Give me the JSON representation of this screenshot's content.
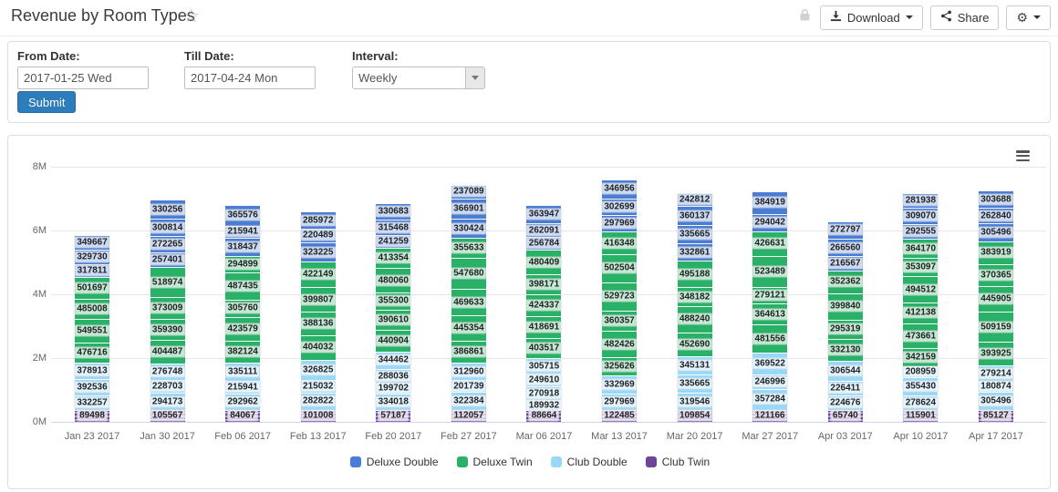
{
  "header": {
    "title": "Revenue by Room Types",
    "download_label": "Download",
    "share_label": "Share"
  },
  "icons": {
    "star": "☆",
    "gear": "⚙"
  },
  "filters": {
    "from_label": "From Date:",
    "from_value": "2017-01-25 Wed",
    "till_label": "Till Date:",
    "till_value": "2017-04-24 Mon",
    "interval_label": "Interval:",
    "interval_value": "Weekly",
    "submit_label": "Submit"
  },
  "chart_data": {
    "type": "bar",
    "stacked": true,
    "title": "",
    "xlabel": "",
    "ylabel": "",
    "ylim_m": [
      0,
      8
    ],
    "grid": true,
    "legend_position": "bottom",
    "y_ticks": [
      {
        "label": "0M",
        "m": 0
      },
      {
        "label": "2M",
        "m": 2
      },
      {
        "label": "4M",
        "m": 4
      },
      {
        "label": "6M",
        "m": 6
      },
      {
        "label": "8M",
        "m": 8
      }
    ],
    "series": [
      {
        "name": "Deluxe Double",
        "color": "#4a7dd4"
      },
      {
        "name": "Deluxe Twin",
        "color": "#28b167"
      },
      {
        "name": "Club Double",
        "color": "#99d8f9"
      },
      {
        "name": "Club Twin",
        "color": "#6f4499"
      }
    ],
    "categories": [
      "Jan 23 2017",
      "Jan 30 2017",
      "Feb 06 2017",
      "Feb 13 2017",
      "Feb 20 2017",
      "Feb 27 2017",
      "Mar 06 2017",
      "Mar 13 2017",
      "Mar 20 2017",
      "Mar 27 2017",
      "Apr 03 2017",
      "Apr 10 2017",
      "Apr 17 2017"
    ],
    "segment_order": "top-to-bottom, second item is series index",
    "bars": [
      {
        "category": "Jan 23 2017",
        "total_m": 5.86,
        "segments": [
          [
            349667,
            0
          ],
          [
            329730,
            0
          ],
          [
            317811,
            0
          ],
          [
            501697,
            1
          ],
          [
            485008,
            1
          ],
          [
            549551,
            1
          ],
          [
            476716,
            1
          ],
          [
            378913,
            2
          ],
          [
            392536,
            2
          ],
          [
            332257,
            2
          ],
          [
            89498,
            3
          ]
        ]
      },
      {
        "category": "Jan 30 2017",
        "total_m": 6.97,
        "segments": [
          [
            330256,
            0
          ],
          [
            300814,
            0
          ],
          [
            272265,
            0
          ],
          [
            257401,
            0
          ],
          [
            518974,
            1
          ],
          [
            373009,
            1
          ],
          [
            359390,
            1
          ],
          [
            404487,
            1
          ],
          [
            276748,
            2
          ],
          [
            228703,
            2
          ],
          [
            294173,
            2
          ],
          [
            105567,
            3
          ]
        ]
      },
      {
        "category": "Feb 06 2017",
        "total_m": 6.8,
        "segments": [
          [
            365576,
            0
          ],
          [
            215941,
            0
          ],
          [
            318437,
            0
          ],
          [
            294899,
            1
          ],
          [
            487435,
            1
          ],
          [
            305760,
            1
          ],
          [
            423579,
            1
          ],
          [
            382124,
            1
          ],
          [
            335111,
            2
          ],
          [
            215941,
            2
          ],
          [
            292962,
            2
          ],
          [
            84067,
            3
          ]
        ]
      },
      {
        "category": "Feb 13 2017",
        "total_m": 6.6,
        "segments": [
          [
            285972,
            0
          ],
          [
            220489,
            0
          ],
          [
            323225,
            0
          ],
          [
            422149,
            1
          ],
          [
            399807,
            1
          ],
          [
            388136,
            1
          ],
          [
            404032,
            1
          ],
          [
            326825,
            2
          ],
          [
            215032,
            2
          ],
          [
            282822,
            2
          ],
          [
            101008,
            3
          ]
        ]
      },
      {
        "category": "Feb 20 2017",
        "total_m": 6.86,
        "segments": [
          [
            330683,
            0
          ],
          [
            315468,
            0
          ],
          [
            241259,
            0
          ],
          [
            413354,
            1
          ],
          [
            480060,
            1
          ],
          [
            355300,
            1
          ],
          [
            390610,
            1
          ],
          [
            440904,
            1
          ],
          [
            344462,
            2
          ],
          [
            288036,
            2
          ],
          [
            199702,
            2
          ],
          [
            334018,
            2
          ],
          [
            57187,
            3
          ]
        ]
      },
      {
        "category": "Feb 27 2017",
        "total_m": 7.43,
        "segments": [
          [
            237089,
            0
          ],
          [
            366901,
            0
          ],
          [
            330424,
            0
          ],
          [
            355633,
            1
          ],
          [
            547680,
            1
          ],
          [
            469633,
            1
          ],
          [
            445354,
            1
          ],
          [
            386861,
            1
          ],
          [
            312960,
            2
          ],
          [
            201739,
            2
          ],
          [
            322384,
            2
          ],
          [
            112057,
            3
          ]
        ]
      },
      {
        "category": "Mar 06 2017",
        "total_m": 6.8,
        "segments": [
          [
            363947,
            0
          ],
          [
            262091,
            0
          ],
          [
            256784,
            0
          ],
          [
            480409,
            1
          ],
          [
            398171,
            1
          ],
          [
            424337,
            1
          ],
          [
            418691,
            1
          ],
          [
            403517,
            1
          ],
          [
            305715,
            2
          ],
          [
            249610,
            2
          ],
          [
            270918,
            2
          ],
          [
            189932,
            2
          ],
          [
            88664,
            3
          ]
        ]
      },
      {
        "category": "Mar 13 2017",
        "total_m": 7.6,
        "segments": [
          [
            346956,
            0
          ],
          [
            302699,
            0
          ],
          [
            297969,
            0
          ],
          [
            416348,
            1
          ],
          [
            502504,
            1
          ],
          [
            529723,
            1
          ],
          [
            360357,
            1
          ],
          [
            482426,
            1
          ],
          [
            325626,
            1
          ],
          [
            332969,
            2
          ],
          [
            297969,
            2
          ],
          [
            122485,
            3
          ]
        ]
      },
      {
        "category": "Mar 20 2017",
        "total_m": 7.18,
        "segments": [
          [
            242812,
            0
          ],
          [
            360137,
            0
          ],
          [
            335665,
            0
          ],
          [
            332861,
            0
          ],
          [
            495188,
            1
          ],
          [
            348182,
            1
          ],
          [
            488240,
            1
          ],
          [
            452690,
            1
          ],
          [
            345131,
            2
          ],
          [
            335665,
            2
          ],
          [
            319546,
            2
          ],
          [
            109854,
            3
          ]
        ]
      },
      {
        "category": "Mar 27 2017",
        "total_m": 7.23,
        "segments": [
          [
            384919,
            0
          ],
          [
            294042,
            0
          ],
          [
            426631,
            1
          ],
          [
            523489,
            1
          ],
          [
            279121,
            1
          ],
          [
            364613,
            1
          ],
          [
            481556,
            1
          ],
          [
            369522,
            2
          ],
          [
            246996,
            2
          ],
          [
            357284,
            2
          ],
          [
            121166,
            3
          ]
        ]
      },
      {
        "category": "Apr 03 2017",
        "total_m": 6.3,
        "segments": [
          [
            272797,
            0
          ],
          [
            266560,
            0
          ],
          [
            216567,
            0
          ],
          [
            352362,
            1
          ],
          [
            399840,
            1
          ],
          [
            295319,
            1
          ],
          [
            332130,
            1
          ],
          [
            306544,
            2
          ],
          [
            226411,
            2
          ],
          [
            224676,
            2
          ],
          [
            65740,
            3
          ]
        ]
      },
      {
        "category": "Apr 10 2017",
        "total_m": 7.17,
        "segments": [
          [
            281938,
            0
          ],
          [
            309070,
            0
          ],
          [
            292555,
            0
          ],
          [
            364170,
            1
          ],
          [
            353097,
            1
          ],
          [
            494512,
            1
          ],
          [
            412138,
            1
          ],
          [
            473661,
            1
          ],
          [
            342159,
            1
          ],
          [
            208959,
            2
          ],
          [
            355430,
            2
          ],
          [
            278624,
            2
          ],
          [
            115901,
            3
          ]
        ]
      },
      {
        "category": "Apr 17 2017",
        "total_m": 7.26,
        "segments": [
          [
            303688,
            0
          ],
          [
            262840,
            0
          ],
          [
            305496,
            0
          ],
          [
            383919,
            1
          ],
          [
            370365,
            1
          ],
          [
            445905,
            1
          ],
          [
            509159,
            1
          ],
          [
            393925,
            1
          ],
          [
            279214,
            2
          ],
          [
            180874,
            2
          ],
          [
            305496,
            2
          ],
          [
            85127,
            3
          ]
        ]
      }
    ]
  }
}
